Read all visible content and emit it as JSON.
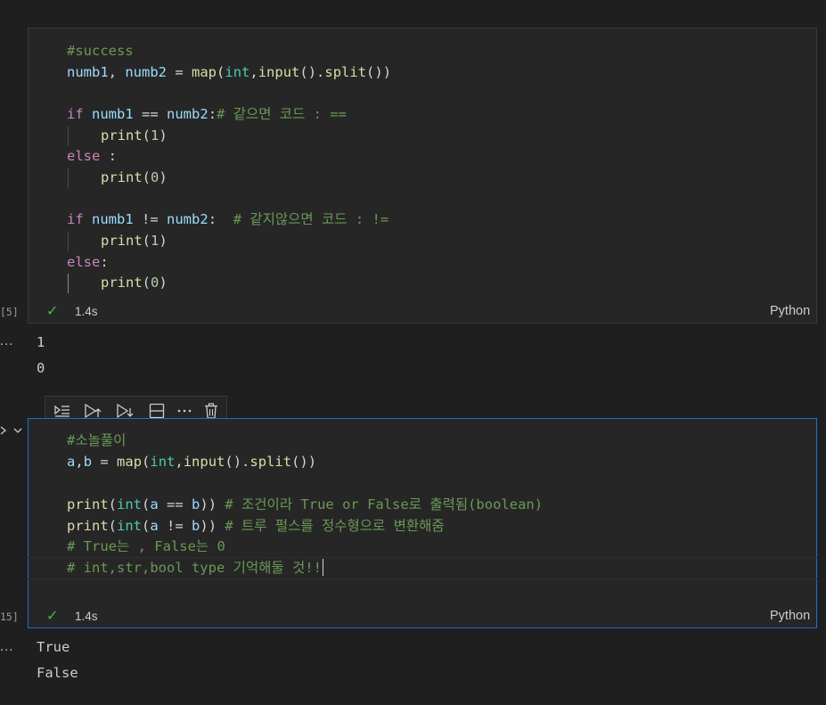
{
  "cell1": {
    "code": {
      "l1": "#success",
      "l2_a": "numb1",
      "l2_b": ", ",
      "l2_c": "numb2",
      "l2_d": " = ",
      "l2_e": "map",
      "l2_f": "(",
      "l2_g": "int",
      "l2_h": ",",
      "l2_i": "input",
      "l2_j": "().",
      "l2_k": "split",
      "l2_l": "())",
      "l4_kw": "if",
      "l4_a": "numb1",
      "l4_b": " == ",
      "l4_c": "numb2",
      "l4_d": ":",
      "l4_cm": "# 같으면 코드 : ==",
      "l5_fn": "print",
      "l5_a": "(",
      "l5_n": "1",
      "l5_b": ")",
      "l6_kw": "else",
      "l6_a": " :",
      "l7_fn": "print",
      "l7_a": "(",
      "l7_n": "0",
      "l7_b": ")",
      "l9_kw": "if",
      "l9_a": "numb1",
      "l9_b": " != ",
      "l9_c": "numb2",
      "l9_d": ":  ",
      "l9_cm": "# 같지않으면 코드 : !=",
      "l10_fn": "print",
      "l10_a": "(",
      "l10_n": "1",
      "l10_b": ")",
      "l11_kw": "else",
      "l11_a": ":",
      "l12_fn": "print",
      "l12_a": "(",
      "l12_n": "0",
      "l12_b": ")"
    },
    "exec_count": "[5]",
    "status_time": "1.4s",
    "language": "Python",
    "outputs": [
      "1",
      "0"
    ]
  },
  "cell2": {
    "code": {
      "l1": "#소놀풀이",
      "l2_a": "a",
      "l2_b": ",",
      "l2_c": "b",
      "l2_d": " = ",
      "l2_e": "map",
      "l2_f": "(",
      "l2_g": "int",
      "l2_h": ",",
      "l2_i": "input",
      "l2_j": "().",
      "l2_k": "split",
      "l2_l": "())",
      "l4_fn": "print",
      "l4_a": "(",
      "l4_ty": "int",
      "l4_b": "(",
      "l4_v1": "a",
      "l4_op": " == ",
      "l4_v2": "b",
      "l4_c": ")) ",
      "l4_cm": "# 조건이라 True or False로 출력됨(boolean)",
      "l5_fn": "print",
      "l5_a": "(",
      "l5_ty": "int",
      "l5_b": "(",
      "l5_v1": "a",
      "l5_op": " != ",
      "l5_v2": "b",
      "l5_c": ")) ",
      "l5_cm": "# 트루 펄스를 정수형으로 변환해줌",
      "l6_cm": "# True는 , False는 0",
      "l7_cm": "# int,str,bool type 기억해둘 것!!"
    },
    "exec_count": "15]",
    "status_time": "1.4s",
    "language": "Python",
    "outputs": [
      "True",
      "False"
    ]
  },
  "toolbar": {
    "icons": [
      "execute-above-icon",
      "run-above-icon",
      "run-below-icon",
      "split-cell-icon",
      "more-icon",
      "delete-icon"
    ]
  },
  "gutter": {
    "ellipsis": "..."
  }
}
